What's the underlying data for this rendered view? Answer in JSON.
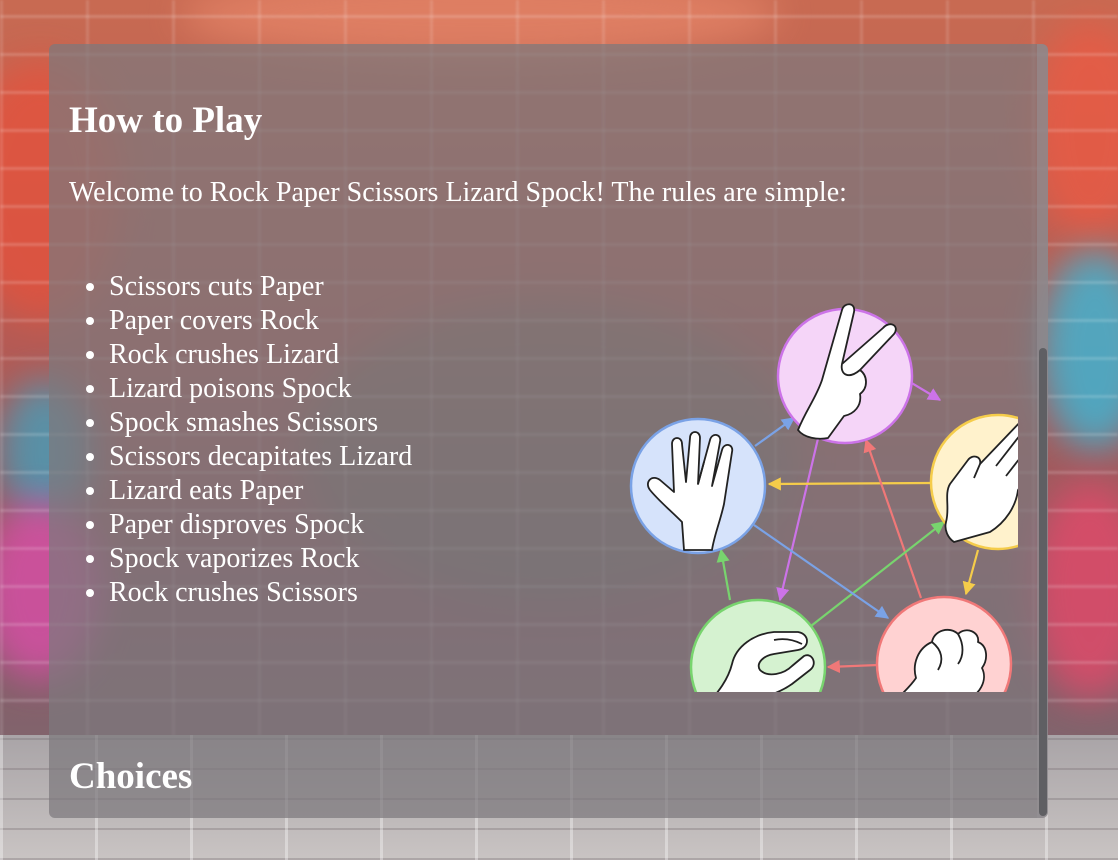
{
  "help": {
    "title": "How to Play",
    "intro": "Welcome to Rock Paper Scissors Lizard Spock! The rules are simple:",
    "rules": [
      "Scissors cuts Paper",
      "Paper covers Rock",
      "Rock crushes Lizard",
      "Lizard poisons Spock",
      "Spock smashes Scissors",
      "Scissors decapitates Lizard",
      "Lizard eats Paper",
      "Paper disproves Spock",
      "Spock vaporizes Rock",
      "Rock crushes Scissors"
    ],
    "choices_title": "Choices"
  },
  "diagram": {
    "nodes": [
      {
        "id": "scissors",
        "icon": "scissors-hand-icon",
        "fill": "#f5d5f8",
        "stroke": "#cc73e8"
      },
      {
        "id": "paper",
        "icon": "paper-hand-icon",
        "fill": "#fff2cc",
        "stroke": "#f5cc4a"
      },
      {
        "id": "rock",
        "icon": "rock-fist-icon",
        "fill": "#ffd2d2",
        "stroke": "#f07878"
      },
      {
        "id": "lizard",
        "icon": "lizard-hand-icon",
        "fill": "#d5f2d0",
        "stroke": "#78d46e"
      },
      {
        "id": "spock",
        "icon": "spock-hand-icon",
        "fill": "#d6e3fb",
        "stroke": "#7aa2e6"
      }
    ]
  }
}
